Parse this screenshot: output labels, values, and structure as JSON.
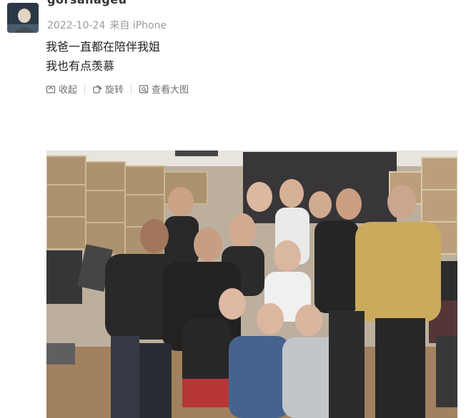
{
  "post": {
    "username": "gorsanageu",
    "date": "2022-10-24",
    "source": "来自 iPhone",
    "lines": [
      "我爸一直都在陪伴我姐",
      "我也有点羡慕"
    ]
  },
  "actions": {
    "collect": "收起",
    "repost": "旋转",
    "view_large": "查看大图"
  }
}
